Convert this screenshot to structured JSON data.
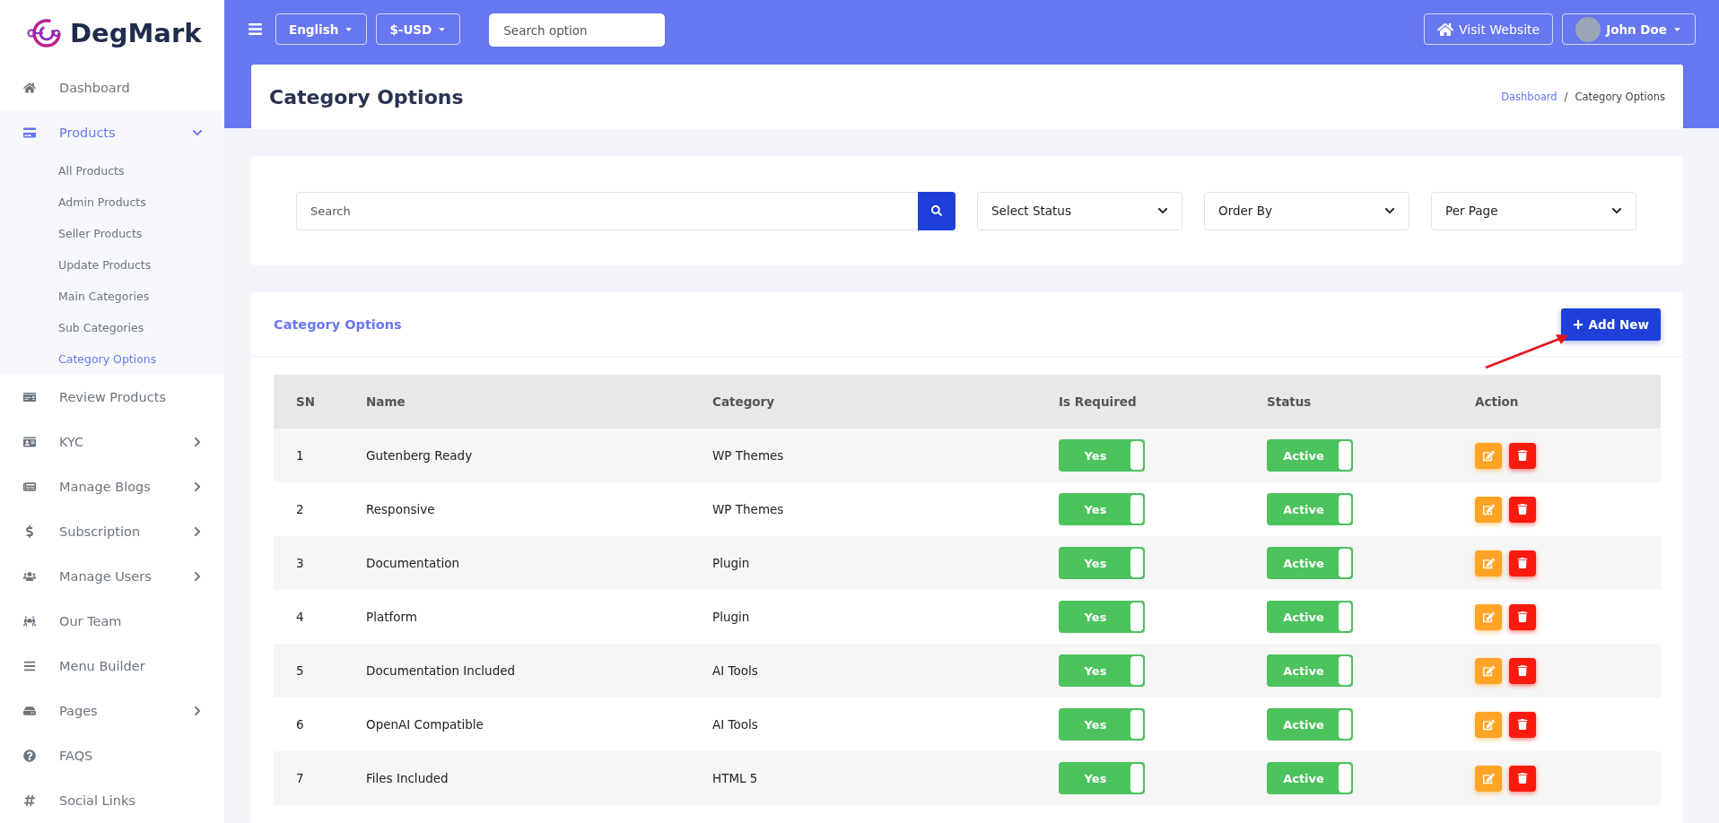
{
  "brand": {
    "name": "DegMark"
  },
  "sidebar": {
    "items": [
      {
        "label": "Dashboard",
        "expandable": false,
        "selected": false
      },
      {
        "label": "Products",
        "expandable": true,
        "expanded": true,
        "selected": true,
        "children": [
          {
            "label": "All Products",
            "selected": false
          },
          {
            "label": "Admin Products",
            "selected": false
          },
          {
            "label": "Seller Products",
            "selected": false
          },
          {
            "label": "Update Products",
            "selected": false
          },
          {
            "label": "Main Categories",
            "selected": false
          },
          {
            "label": "Sub Categories",
            "selected": false
          },
          {
            "label": "Category Options",
            "selected": true
          }
        ]
      },
      {
        "label": "Review Products",
        "expandable": false,
        "selected": false
      },
      {
        "label": "KYC",
        "expandable": true,
        "expanded": false,
        "selected": false
      },
      {
        "label": "Manage Blogs",
        "expandable": true,
        "expanded": false,
        "selected": false
      },
      {
        "label": "Subscription",
        "expandable": true,
        "expanded": false,
        "selected": false
      },
      {
        "label": "Manage Users",
        "expandable": true,
        "expanded": false,
        "selected": false
      },
      {
        "label": "Our Team",
        "expandable": false,
        "selected": false
      },
      {
        "label": "Menu Builder",
        "expandable": false,
        "selected": false
      },
      {
        "label": "Pages",
        "expandable": true,
        "expanded": false,
        "selected": false
      },
      {
        "label": "FAQS",
        "expandable": false,
        "selected": false
      },
      {
        "label": "Social Links",
        "expandable": false,
        "selected": false
      }
    ]
  },
  "topbar": {
    "language": "English",
    "currency": "$-USD",
    "search": {
      "placeholder": "Search option"
    },
    "visit_website": "Visit Website",
    "user": "John Doe"
  },
  "page": {
    "title": "Category Options",
    "breadcrumb": [
      {
        "label": "Dashboard",
        "kind": "link"
      },
      {
        "label": "/",
        "kind": "separator"
      },
      {
        "label": "Category Options",
        "kind": "current"
      }
    ]
  },
  "filters": {
    "search": {
      "placeholder": "Search"
    },
    "selects": [
      "Select Status",
      "Order By",
      "Per Page"
    ]
  },
  "table_card": {
    "title": "Category Options",
    "add_button": "Add New",
    "columns": [
      "SN",
      "Name",
      "Category",
      "Is Required",
      "Status",
      "Action"
    ],
    "rows": [
      {
        "sn": "1",
        "name": "Gutenberg Ready",
        "category": "WP Themes",
        "required": {
          "label": "Yes",
          "on": true
        },
        "status": {
          "label": "Active",
          "on": true
        }
      },
      {
        "sn": "2",
        "name": "Responsive",
        "category": "WP Themes",
        "required": {
          "label": "Yes",
          "on": true
        },
        "status": {
          "label": "Active",
          "on": true
        }
      },
      {
        "sn": "3",
        "name": "Documentation",
        "category": "Plugin",
        "required": {
          "label": "Yes",
          "on": true
        },
        "status": {
          "label": "Active",
          "on": true
        }
      },
      {
        "sn": "4",
        "name": "Platform",
        "category": "Plugin",
        "required": {
          "label": "Yes",
          "on": true
        },
        "status": {
          "label": "Active",
          "on": true
        }
      },
      {
        "sn": "5",
        "name": "Documentation Included",
        "category": "AI Tools",
        "required": {
          "label": "Yes",
          "on": true
        },
        "status": {
          "label": "Active",
          "on": true
        }
      },
      {
        "sn": "6",
        "name": "OpenAI Compatible",
        "category": "AI Tools",
        "required": {
          "label": "Yes",
          "on": true
        },
        "status": {
          "label": "Active",
          "on": true
        }
      },
      {
        "sn": "7",
        "name": "Files Included",
        "category": "HTML 5",
        "required": {
          "label": "Yes",
          "on": true
        },
        "status": {
          "label": "Active",
          "on": true
        }
      }
    ]
  }
}
